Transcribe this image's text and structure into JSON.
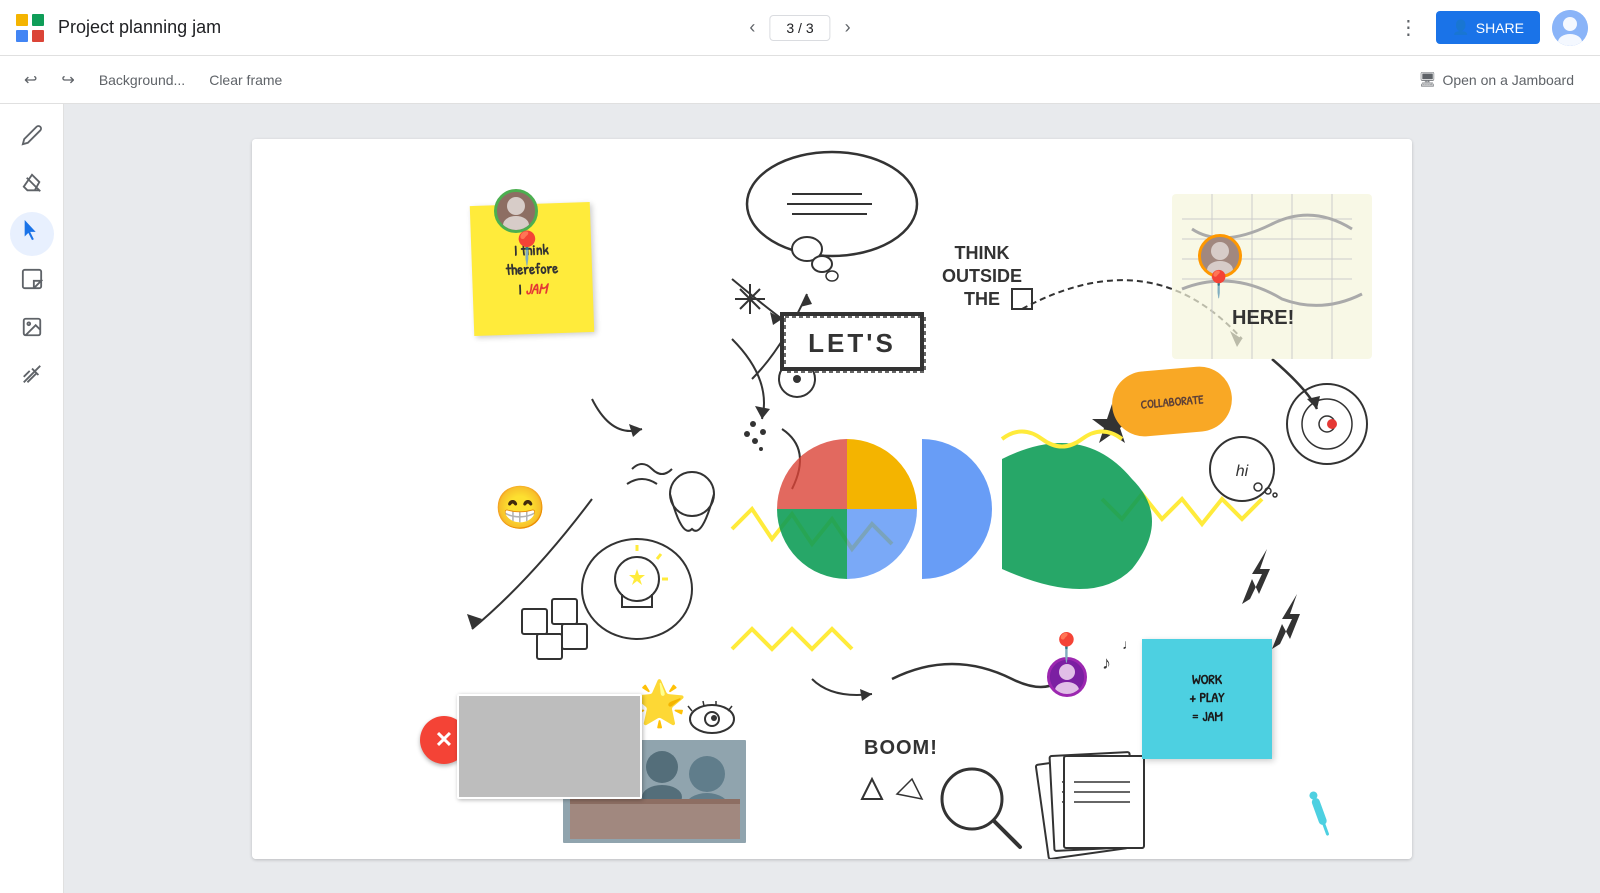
{
  "header": {
    "title": "Project planning jam",
    "nav": {
      "prev_label": "‹",
      "next_label": "›",
      "page_indicator": "3 / 3"
    },
    "more_icon": "⋮",
    "share_label": "SHARE",
    "share_icon": "👤"
  },
  "toolbar": {
    "undo_icon": "↩",
    "redo_icon": "↪",
    "background_label": "Background...",
    "clear_frame_label": "Clear frame",
    "open_jamboard_label": "Open on a Jamboard",
    "open_jamboard_icon": "🖥"
  },
  "left_tools": {
    "pen_icon": "✏",
    "eraser_icon": "◻",
    "select_icon": "↖",
    "sticky_icon": "📋",
    "image_icon": "🖼",
    "laser_icon": "⚡"
  },
  "canvas": {
    "sticky_yellow": {
      "line1": "I think",
      "line2": "therefore",
      "line3": "I",
      "line4": "JAM"
    },
    "sticky_cyan": {
      "line1": "WORK",
      "line2": "+ PLAY",
      "line3": "= JAM"
    },
    "collaborate": "COLLABORATE",
    "lets": "LET'S",
    "think_outside": "THINK\nOUTSIDE\nTHE",
    "here_label": "HERE!",
    "boom": "BOOM!",
    "hi": "hi"
  }
}
